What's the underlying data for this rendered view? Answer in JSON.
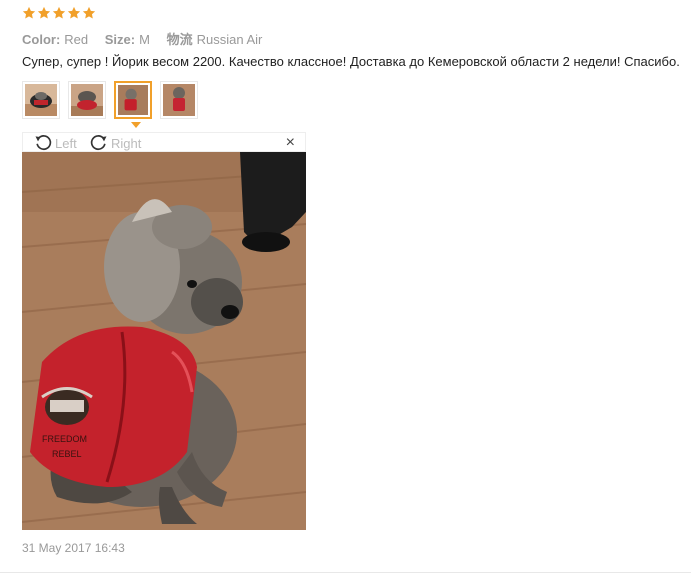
{
  "rating": {
    "stars": 5,
    "color": "#f1a02a"
  },
  "meta": {
    "color_label": "Color:",
    "color_value": "Red",
    "size_label": "Size:",
    "size_value": "M",
    "shipping_label": "物流",
    "shipping_value": "Russian Air"
  },
  "review_text": "Супер, супер ! Йорик весом 2200. Качество классное! Доставка до Кемеровской области 2 недели! Спасибо.",
  "viewer": {
    "rotate_left_label": "Left",
    "rotate_right_label": "Right",
    "close_label": "×"
  },
  "date": "31 May 2017 16:43"
}
